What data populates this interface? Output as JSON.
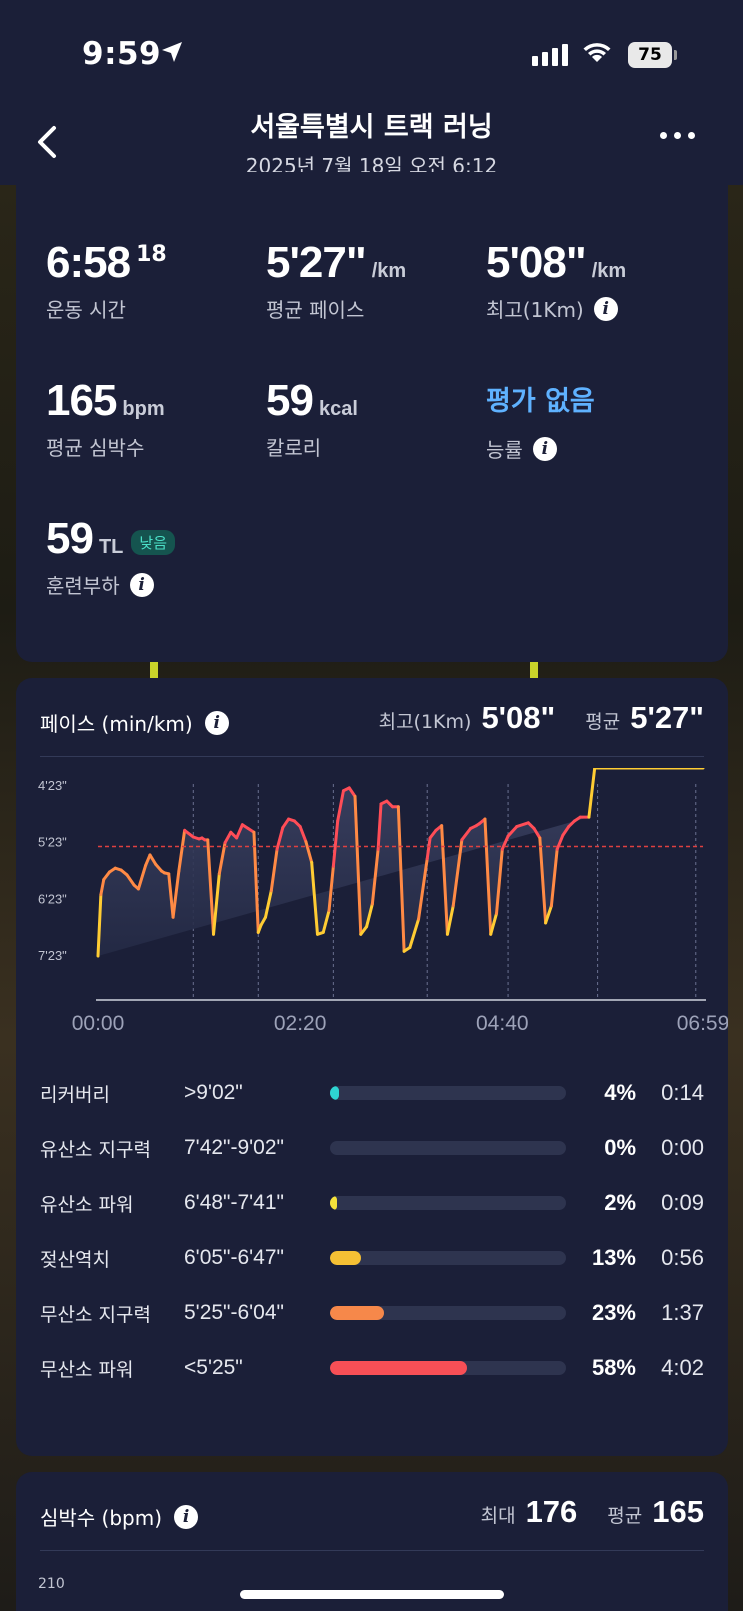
{
  "status_bar": {
    "time": "9:59",
    "battery": "75"
  },
  "header": {
    "title": "서울특별시 트랙 러닝",
    "subtitle": "2025년 7월 18일 오전 6:12"
  },
  "stats": {
    "duration": {
      "value": "6:58",
      "sup": "18",
      "label": "운동 시간"
    },
    "avg_pace": {
      "value": "5'27\"",
      "unit": "/km",
      "label": "평균 페이스"
    },
    "best_pace": {
      "value": "5'08\"",
      "unit": "/km",
      "label": "최고(1Km)"
    },
    "avg_hr": {
      "value": "165",
      "unit": "bpm",
      "label": "평균 심박수"
    },
    "calories": {
      "value": "59",
      "unit": "kcal",
      "label": "칼로리"
    },
    "efficiency": {
      "value": "평가 없음",
      "label": "능률"
    },
    "training_load": {
      "value": "59",
      "unit": "TL",
      "badge": "낮음",
      "label": "훈련부하"
    }
  },
  "pace_card": {
    "title": "페이스 (min/km)",
    "best_label": "최고(1Km)",
    "best_value": "5'08\"",
    "avg_label": "평균",
    "avg_value": "5'27\""
  },
  "chart_data": {
    "type": "area",
    "y_ticks": [
      "4'23\"",
      "5'23\"",
      "6'23\"",
      "7'23\""
    ],
    "x_ticks": [
      "00:00",
      "02:20",
      "04:40",
      "06:59"
    ],
    "y_inverted": true,
    "average_line": "5'27\"",
    "colors": {
      "fast": "#ff4d57",
      "mid": "#ff8a45",
      "slow": "#ffcc33",
      "avg_line": "#e04040"
    },
    "x": [
      0,
      2,
      4,
      8,
      12,
      16,
      20,
      25,
      28,
      33,
      36,
      40,
      44,
      46,
      49,
      52,
      56,
      60,
      66,
      70,
      72,
      74,
      76,
      80,
      84,
      88,
      92,
      96,
      100,
      104,
      108,
      111,
      113,
      116,
      120,
      124,
      128,
      132,
      136,
      140,
      144,
      148,
      152,
      156,
      160,
      163,
      166,
      170,
      174,
      178,
      182,
      186,
      190,
      194,
      196,
      200,
      204,
      208,
      212,
      216,
      222,
      228,
      230,
      234,
      238,
      242,
      246,
      252,
      258,
      262,
      264,
      268,
      272,
      276,
      280,
      284,
      290,
      298,
      302,
      306,
      310,
      314,
      318,
      322,
      326,
      330,
      334,
      340,
      344,
      346,
      350,
      354,
      358,
      362,
      366,
      370,
      376,
      380,
      384,
      388,
      392,
      396,
      400,
      404,
      408,
      412,
      419
    ],
    "pace_sec": [
      443,
      378,
      362,
      354,
      350,
      352,
      357,
      368,
      372,
      347,
      336,
      346,
      353,
      355,
      356,
      402,
      353,
      310,
      317,
      319,
      318,
      320,
      320,
      420,
      356,
      323,
      312,
      318,
      304,
      308,
      312,
      418,
      410,
      402,
      374,
      330,
      307,
      298,
      300,
      306,
      322,
      344,
      420,
      418,
      395,
      348,
      300,
      268,
      265,
      274,
      420,
      412,
      388,
      330,
      282,
      279,
      285,
      285,
      438,
      434,
      404,
      340,
      318,
      310,
      305,
      420,
      390,
      320,
      308,
      305,
      303,
      298,
      420,
      398,
      330,
      316,
      306,
      302,
      308,
      318,
      408,
      390,
      330,
      315,
      306,
      300,
      296,
      296
    ]
  },
  "zones": [
    {
      "name": "리커버리",
      "range": ">9'02\"",
      "pct": "4%",
      "time": "0:14",
      "fill": 0.04,
      "color": "#2ed3d1"
    },
    {
      "name": "유산소 지구력",
      "range": "7'42\"-9'02\"",
      "pct": "0%",
      "time": "0:00",
      "fill": 0.0,
      "color": "#3a8bd8"
    },
    {
      "name": "유산소 파워",
      "range": "6'48\"-7'41\"",
      "pct": "2%",
      "time": "0:09",
      "fill": 0.02,
      "color": "#f5e23b"
    },
    {
      "name": "젖산역치",
      "range": "6'05\"-6'47\"",
      "pct": "13%",
      "time": "0:56",
      "fill": 0.13,
      "color": "#f5c034"
    },
    {
      "name": "무산소 지구력",
      "range": "5'25\"-6'04\"",
      "pct": "23%",
      "time": "1:37",
      "fill": 0.23,
      "color": "#f6884a"
    },
    {
      "name": "무산소 파워",
      "range": "<5'25\"",
      "pct": "58%",
      "time": "4:02",
      "fill": 0.58,
      "color": "#f74f56"
    }
  ],
  "hr_card": {
    "title": "심박수 (bpm)",
    "max_label": "최대",
    "max_value": "176",
    "avg_label": "평균",
    "avg_value": "165",
    "top_tick": "210"
  }
}
